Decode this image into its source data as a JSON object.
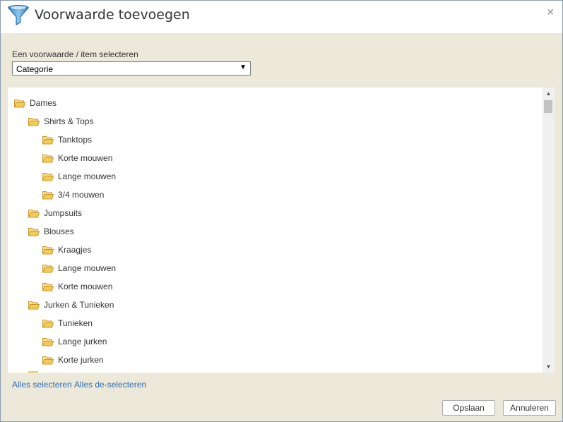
{
  "dialog": {
    "title": "Voorwaarde toevoegen",
    "close_symbol": "×"
  },
  "select": {
    "label": "Een voorwaarde / item selecteren",
    "value": "Categorie",
    "arrow": "▼"
  },
  "tree": {
    "items": [
      {
        "label": "Dames",
        "level": 0
      },
      {
        "label": "Shirts & Tops",
        "level": 1
      },
      {
        "label": "Tanktops",
        "level": 2
      },
      {
        "label": "Korte mouwen",
        "level": 2
      },
      {
        "label": "Lange mouwen",
        "level": 2
      },
      {
        "label": "3/4 mouwen",
        "level": 2
      },
      {
        "label": "Jumpsuits",
        "level": 1
      },
      {
        "label": "Blouses",
        "level": 1
      },
      {
        "label": "Kraagjes",
        "level": 2
      },
      {
        "label": "Lange mouwen",
        "level": 2
      },
      {
        "label": "Korte mouwen",
        "level": 2
      },
      {
        "label": "Jurken & Tunieken",
        "level": 1
      },
      {
        "label": "Tunieken",
        "level": 2
      },
      {
        "label": "Lange jurken",
        "level": 2
      },
      {
        "label": "Korte jurken",
        "level": 2
      }
    ],
    "scroll_up": "▲",
    "scroll_down": "▼"
  },
  "links": {
    "select_all": "Alles selecteren",
    "deselect_all": "Alles de-selecteren"
  },
  "buttons": {
    "save": "Opslaan",
    "cancel": "Annuleren"
  },
  "colors": {
    "dialog_bg": "#ece8da",
    "link": "#2c6fb3",
    "folder": "#f5c95a"
  }
}
